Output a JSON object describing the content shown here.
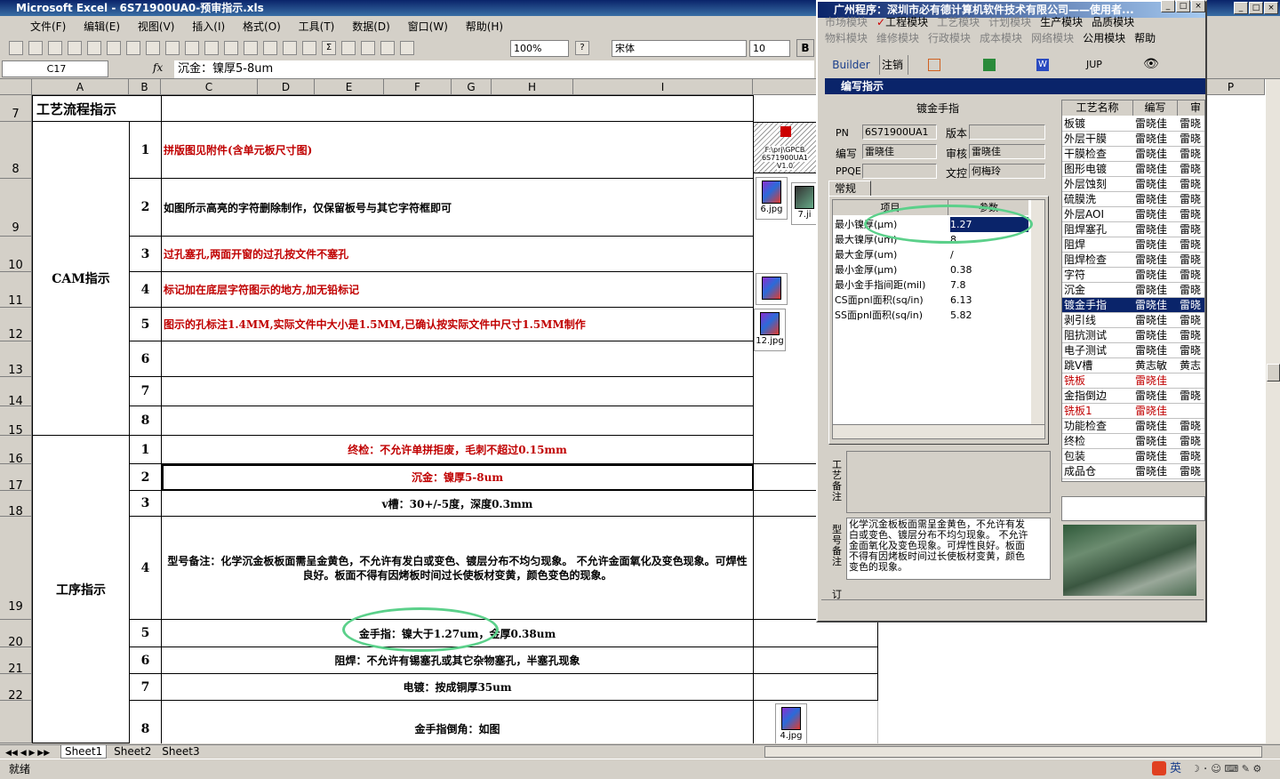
{
  "excel": {
    "title": "Microsoft Excel - 6S71900UA0-预审指示.xls",
    "menu": [
      "文件(F)",
      "编辑(E)",
      "视图(V)",
      "插入(I)",
      "格式(O)",
      "工具(T)",
      "数据(D)",
      "窗口(W)",
      "帮助(H)"
    ],
    "zoom": "100%",
    "font": "宋体",
    "fontsize": "10",
    "bold_btn": "B",
    "namebox": "C17",
    "fx": "fx",
    "formula": "沉金：镍厚5-8um",
    "columns": [
      "A",
      "B",
      "C",
      "D",
      "E",
      "F",
      "G",
      "H",
      "I",
      "P"
    ],
    "rows": [
      "7",
      "8",
      "9",
      "10",
      "11",
      "12",
      "13",
      "14",
      "15",
      "16",
      "17",
      "18",
      "19",
      "20",
      "21",
      "22"
    ],
    "header_cell": "工艺流程指示",
    "cam_label": "CAM指示",
    "process_label": "工序指示",
    "cam_items": [
      {
        "n": "1",
        "text": "拼版图见附件(含单元板尺寸图)"
      },
      {
        "n": "2",
        "text": "如图所示高亮的字符删除制作，仅保留板号与其它字符框即可"
      },
      {
        "n": "3",
        "text": "过孔塞孔,两面开窗的过孔按文件不塞孔"
      },
      {
        "n": "4",
        "text": "标记加在底层字符图示的地方,加无铅标记"
      },
      {
        "n": "5",
        "text": "图示的孔标注1.4MM,实际文件中大小是1.5MM,已确认按实际文件中尺寸1.5MM制作"
      },
      {
        "n": "6",
        "text": ""
      },
      {
        "n": "7",
        "text": ""
      },
      {
        "n": "8",
        "text": ""
      }
    ],
    "proc_items": [
      {
        "n": "1",
        "text": "终检：不允许单拼拒废，毛刺不超过0.15mm"
      },
      {
        "n": "2",
        "text": "沉金：镍厚5-8um"
      },
      {
        "n": "3",
        "text": "v槽：30+/-5度，深度0.3mm"
      },
      {
        "n": "4",
        "text": "型号备注：化学沉金板板面需呈金黄色，不允许有发白或变色、镀层分布不均匀现象。 不允许金面氧化及变色现象。可焊性良好。板面不得有因烤板时间过长使板材变黄，颜色变色的现象。"
      },
      {
        "n": "5",
        "text": "金手指：镍大于1.27um，金厚0.38um"
      },
      {
        "n": "6",
        "text": "阻焊：不允许有锡塞孔或其它杂物塞孔，半塞孔现象"
      },
      {
        "n": "7",
        "text": "电镀：按成铜厚35um"
      },
      {
        "n": "8",
        "text": "金手指倒角：如图"
      }
    ],
    "attachments": {
      "a1": "F:\\prj\\GPCB 6S71900UA1 V1.0",
      "a2": "6.jpg",
      "a3": "7.ji",
      "a5": "12.jpg",
      "a8": "4.jpg"
    },
    "sheets": [
      "Sheet1",
      "Sheet2",
      "Sheet3"
    ],
    "status": "就绪",
    "tray": "英"
  },
  "app": {
    "title": "广州程序：深圳市必有德计算机软件技术有限公司——使用者...",
    "modules_row1": [
      "市场模块",
      "工程模块",
      "工艺模块",
      "计划模块",
      "生产模块",
      "品质模块"
    ],
    "modules_row2": [
      "物料模块",
      "维修模块",
      "行政模块",
      "成本模块",
      "网络模块",
      "公用模块",
      "帮助"
    ],
    "toolbar": [
      "Builder",
      "注销",
      "JUP"
    ],
    "dialog_title": "编写指示",
    "section": "镀金手指",
    "pn_label": "PN",
    "pn": "6S71900UA1",
    "version_label": "版本",
    "version": "",
    "author_label": "编写",
    "author": "雷晓佳",
    "reviewer_label": "审核",
    "reviewer": "雷晓佳",
    "ppqe_label": "PPQE",
    "ppqe": "",
    "doc_label": "文控",
    "doc": "何梅玲",
    "tab": "常规",
    "param_headers": [
      "项目",
      "参数"
    ],
    "params": [
      [
        "最小镍厚(μm)",
        "1.27"
      ],
      [
        "最大镍厚(um)",
        "8"
      ],
      [
        "最大金厚(um)",
        "/"
      ],
      [
        "最小金厚(μm)",
        "0.38"
      ],
      [
        "最小金手指间距(mil)",
        "7.8"
      ],
      [
        "CS面pnl面积(sq/in)",
        "6.13"
      ],
      [
        "SS面pnl面积(sq/in)",
        "5.82"
      ]
    ],
    "remark_label": "工艺备注",
    "model_label": "型号备注",
    "model_note": "化学沉金板板面需呈金黄色，不允许有发白或变色、镀层分布不均匀现象。 不允许金面氧化及变色现象。可焊性良好。板面不得有因烤板时间过长使板材变黄，颜色变色的现象。",
    "bottom_label": "订",
    "proc_headers": [
      "工艺名称",
      "编写",
      "审"
    ],
    "processes": [
      [
        "板镀",
        "雷晓佳",
        "雷晓"
      ],
      [
        "外层干膜",
        "雷晓佳",
        "雷晓"
      ],
      [
        "干膜检查",
        "雷晓佳",
        "雷晓"
      ],
      [
        "图形电镀",
        "雷晓佳",
        "雷晓"
      ],
      [
        "外层蚀刻",
        "雷晓佳",
        "雷晓"
      ],
      [
        "硫膜洗",
        "雷晓佳",
        "雷晓"
      ],
      [
        "外层AOI",
        "雷晓佳",
        "雷晓"
      ],
      [
        "阻焊塞孔",
        "雷晓佳",
        "雷晓"
      ],
      [
        "阻焊",
        "雷晓佳",
        "雷晓"
      ],
      [
        "阻焊检查",
        "雷晓佳",
        "雷晓"
      ],
      [
        "字符",
        "雷晓佳",
        "雷晓"
      ],
      [
        "沉金",
        "雷晓佳",
        "雷晓"
      ],
      [
        "镀金手指",
        "雷晓佳",
        "雷晓"
      ],
      [
        "剥引线",
        "雷晓佳",
        "雷晓"
      ],
      [
        "阻抗测试",
        "雷晓佳",
        "雷晓"
      ],
      [
        "电子测试",
        "雷晓佳",
        "雷晓"
      ],
      [
        "跳V槽",
        "黄志敏",
        "黄志"
      ],
      [
        "铣板",
        "雷晓佳",
        ""
      ],
      [
        "金指倒边",
        "雷晓佳",
        "雷晓"
      ],
      [
        "铣板1",
        "雷晓佳",
        ""
      ],
      [
        "功能检查",
        "雷晓佳",
        "雷晓"
      ],
      [
        "终检",
        "雷晓佳",
        "雷晓"
      ],
      [
        "包装",
        "雷晓佳",
        "雷晓"
      ],
      [
        "成品仓",
        "雷晓佳",
        "雷晓"
      ]
    ],
    "highlight_color": "#0a246a",
    "red_color": "#c00000",
    "ellipse_color": "#5bd08a"
  }
}
